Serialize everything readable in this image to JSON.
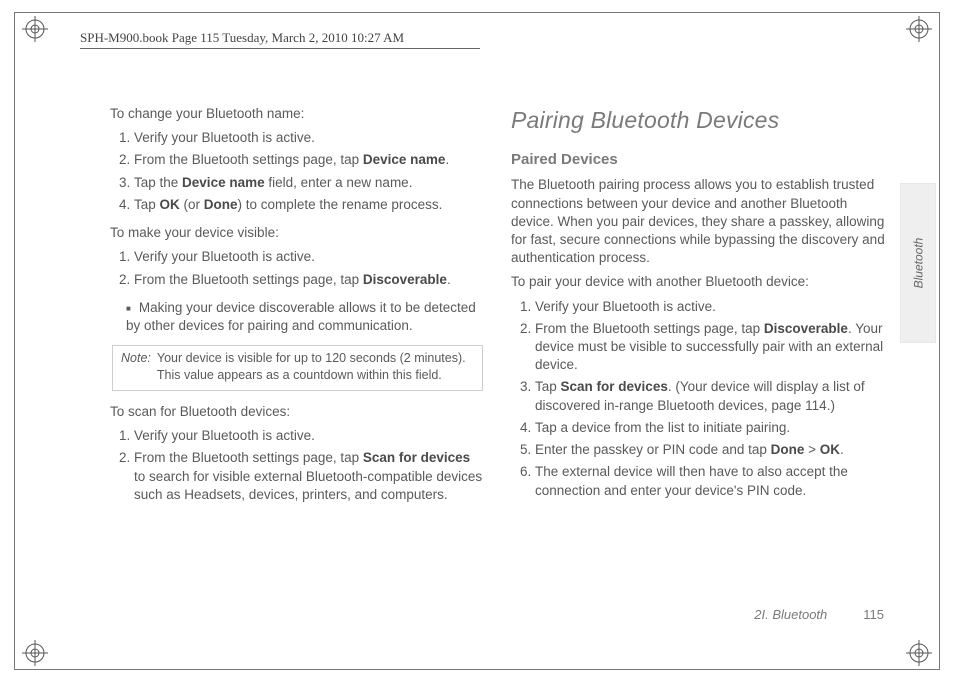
{
  "running_head": "SPH-M900.book  Page 115  Tuesday, March 2, 2010  10:27 AM",
  "side_tab": "Bluetooth",
  "footer": {
    "section": "2I. Bluetooth",
    "page": "115"
  },
  "left": {
    "h_change": "To change your Bluetooth name:",
    "s_change": [
      {
        "pre": "Verify your Bluetooth is active."
      },
      {
        "pre": "From the Bluetooth settings page, tap ",
        "b1": "Device name",
        "post": "."
      },
      {
        "pre": "Tap the ",
        "b1": "Device name",
        "post": " field, enter a new name."
      },
      {
        "pre": "Tap ",
        "b1": "OK",
        "mid": " (or ",
        "b2": "Done",
        "post": ") to complete the rename process."
      }
    ],
    "h_visible": "To make your device visible:",
    "s_visible": [
      {
        "pre": "Verify your Bluetooth is active."
      },
      {
        "pre": "From the Bluetooth settings page, tap ",
        "b1": "Discoverable",
        "post": "."
      }
    ],
    "bullet_visible": "Making your device discoverable allows it to be detected by other devices for pairing and communication.",
    "note_label": "Note:",
    "note_body": "Your device is visible for up to 120 seconds (2 minutes). This value appears as a countdown within this field.",
    "h_scan": "To scan for Bluetooth devices:",
    "s_scan": [
      {
        "pre": "Verify your Bluetooth is active."
      },
      {
        "pre": "From the Bluetooth settings page, tap ",
        "b1": "Scan for devices",
        "post": " to search for visible external Bluetooth-compatible devices such as Headsets, devices, printers, and computers."
      }
    ]
  },
  "right": {
    "title": "Pairing Bluetooth Devices",
    "sub": "Paired Devices",
    "para": "The Bluetooth pairing process allows you to establish trusted connections between your device and another Bluetooth device. When you pair devices, they share a passkey, allowing for fast, secure connections while bypassing the discovery and authentication process.",
    "h_pair": "To pair your device with another Bluetooth device:",
    "s_pair": [
      {
        "pre": "Verify your Bluetooth is active."
      },
      {
        "pre": "From the Bluetooth settings page, tap ",
        "b1": "Discoverable",
        "post": ". Your device must be visible to successfully pair with an external device."
      },
      {
        "pre": "Tap ",
        "b1": "Scan for devices",
        "post": ". (Your device will display a list of discovered in-range Bluetooth devices, page 114.)"
      },
      {
        "pre": "Tap a device from the list to initiate pairing."
      },
      {
        "pre": "Enter the passkey or PIN code and tap ",
        "b1": "Done",
        "mid": " > ",
        "b2": "OK",
        "post": "."
      },
      {
        "pre": "The external device will then have to also accept the connection and enter your device's PIN code."
      }
    ]
  }
}
